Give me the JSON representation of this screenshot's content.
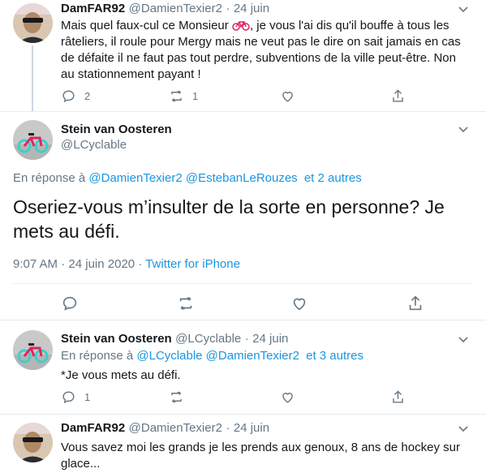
{
  "tweets": [
    {
      "name": "DamFAR92",
      "handle": "@DamienTexier2",
      "date": "24 juin",
      "text_before_emoji": "Mais quel faux-cul ce Monsieur ",
      "text_after_emoji": ", je vous l'ai dis qu'il bouffe à tous les râteliers, il roule pour Mergy mais ne veut pas le dire on sait jamais en cas de défaite il ne faut pas tout perdre, subventions de la ville peut-être. Non au stationnement payant !",
      "reply_count": "2",
      "retweet_count": "1"
    },
    {
      "name": "Stein van Oosteren",
      "handle": "@LCyclable",
      "reply_prefix": "En réponse à",
      "mention_1": "@DamienTexier2",
      "mention_2": "@EstebanLeRouzes",
      "others": "et 2 autres",
      "text": "Oseriez-vous m’insulter de la sorte en personne? Je mets au défi.",
      "time": "9:07 AM",
      "full_date": "24 juin 2020",
      "source": "Twitter for iPhone"
    },
    {
      "name": "Stein van Oosteren",
      "handle": "@LCyclable",
      "date": "24 juin",
      "reply_prefix": "En réponse à",
      "mention_1": "@LCyclable",
      "mention_2": "@DamienTexier2",
      "others": "et 3 autres",
      "text": "*Je vous mets au défi.",
      "reply_count": "1"
    },
    {
      "name": "DamFAR92",
      "handle": "@DamienTexier2",
      "date": "24 juin",
      "text": "Vous savez moi les grands je les prends aux genoux, 8 ans de hockey sur glace..."
    }
  ],
  "separator": "·",
  "colors": {
    "link": "#1b95e0",
    "muted": "#657786",
    "border": "#e6ecf0"
  }
}
